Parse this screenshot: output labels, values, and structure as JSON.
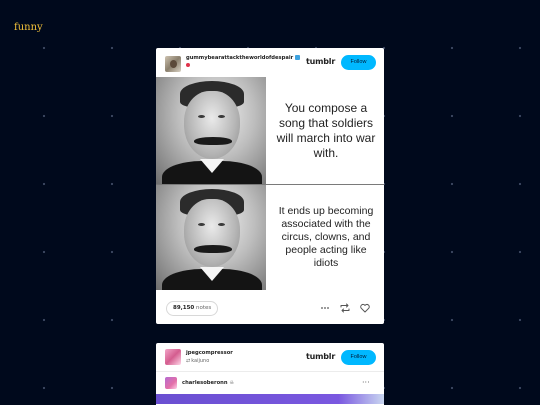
{
  "blog": {
    "title": "funny"
  },
  "post1": {
    "username": "gummybearattacktheworldofdespair",
    "logo": "tumblr",
    "follow_label": "Follow",
    "caption_top": "You compose a song that soldiers will march into war with.",
    "caption_bottom": "It ends up becoming associated with the circus, clowns, and people acting like idiots",
    "notes_count": "89,150",
    "notes_word": "notes",
    "icons": [
      "more-icon",
      "reblog-icon",
      "like-icon"
    ]
  },
  "post2": {
    "username": "jpegcompressor",
    "reblogged_from": "kaijuno",
    "logo": "tumblr",
    "follow_label": "Follow",
    "op_username": "charlesoberonn"
  },
  "colors": {
    "background": "#00091c",
    "title": "#f3c23a",
    "follow_button": "#00b8ff"
  }
}
